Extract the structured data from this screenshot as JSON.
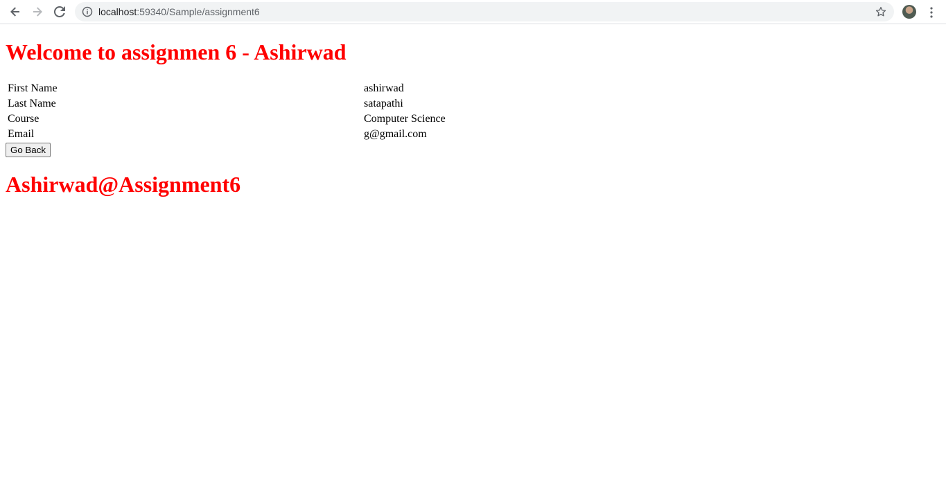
{
  "browser": {
    "url_host": "localhost",
    "url_path": ":59340/Sample/assignment6"
  },
  "page": {
    "title": "Welcome to assignmen 6 - Ashirwad",
    "rows": [
      {
        "label": "First Name",
        "value": "ashirwad"
      },
      {
        "label": "Last Name",
        "value": "satapathi"
      },
      {
        "label": "Course",
        "value": "Computer Science"
      },
      {
        "label": "Email",
        "value": "g@gmail.com"
      }
    ],
    "back_button_label": "Go Back",
    "footer_heading": "Ashirwad@Assignment6"
  },
  "colors": {
    "heading": "#ff0000",
    "omnibox_bg": "#f1f3f4"
  },
  "icons": {
    "back": "arrow-left-icon",
    "forward": "arrow-right-icon",
    "reload": "reload-icon",
    "info": "info-icon",
    "bookmark": "star-icon",
    "menu": "kebab-menu-icon"
  }
}
